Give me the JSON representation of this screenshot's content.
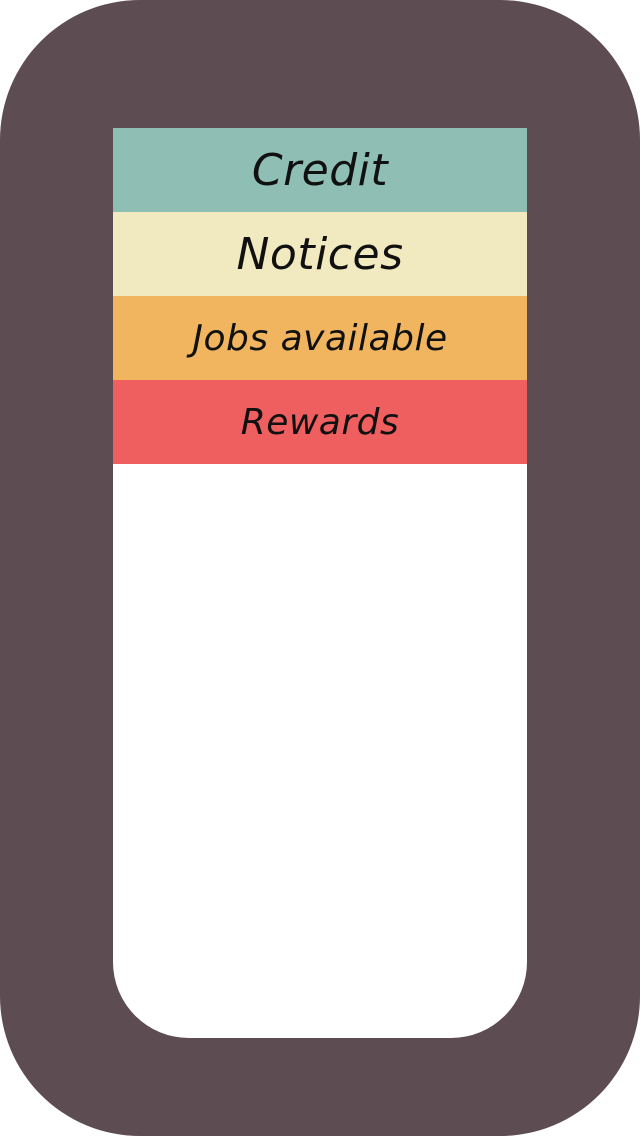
{
  "menu": {
    "items": [
      {
        "label": "Credit",
        "color": "#8fbfb4"
      },
      {
        "label": "Notices",
        "color": "#f1e9c0"
      },
      {
        "label": "Jobs available",
        "color": "#f1b560"
      },
      {
        "label": "Rewards",
        "color": "#ef5f5f"
      }
    ]
  },
  "colors": {
    "device_frame": "#5d4d52",
    "screen_background": "#ffffff"
  }
}
